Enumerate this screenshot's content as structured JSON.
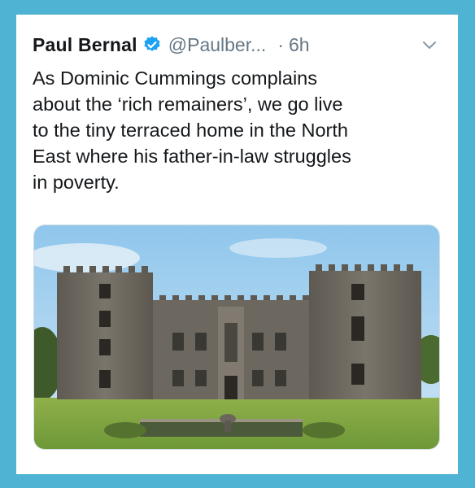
{
  "tweet": {
    "author_name": "Paul Bernal",
    "handle": "@Paulber...",
    "separator": "·",
    "time": "6h",
    "text": "As Dominic Cummings complains\nabout the ‘rich remainers’, we go live\nto the tiny terraced home in the North\nEast where his father-in-law struggles\nin poverty."
  },
  "icons": {
    "verified": "verified-badge-icon",
    "menu": "chevron-down-icon"
  },
  "colors": {
    "background": "#4fb3d4",
    "verified": "#1da1f2",
    "secondary_text": "#657786"
  }
}
